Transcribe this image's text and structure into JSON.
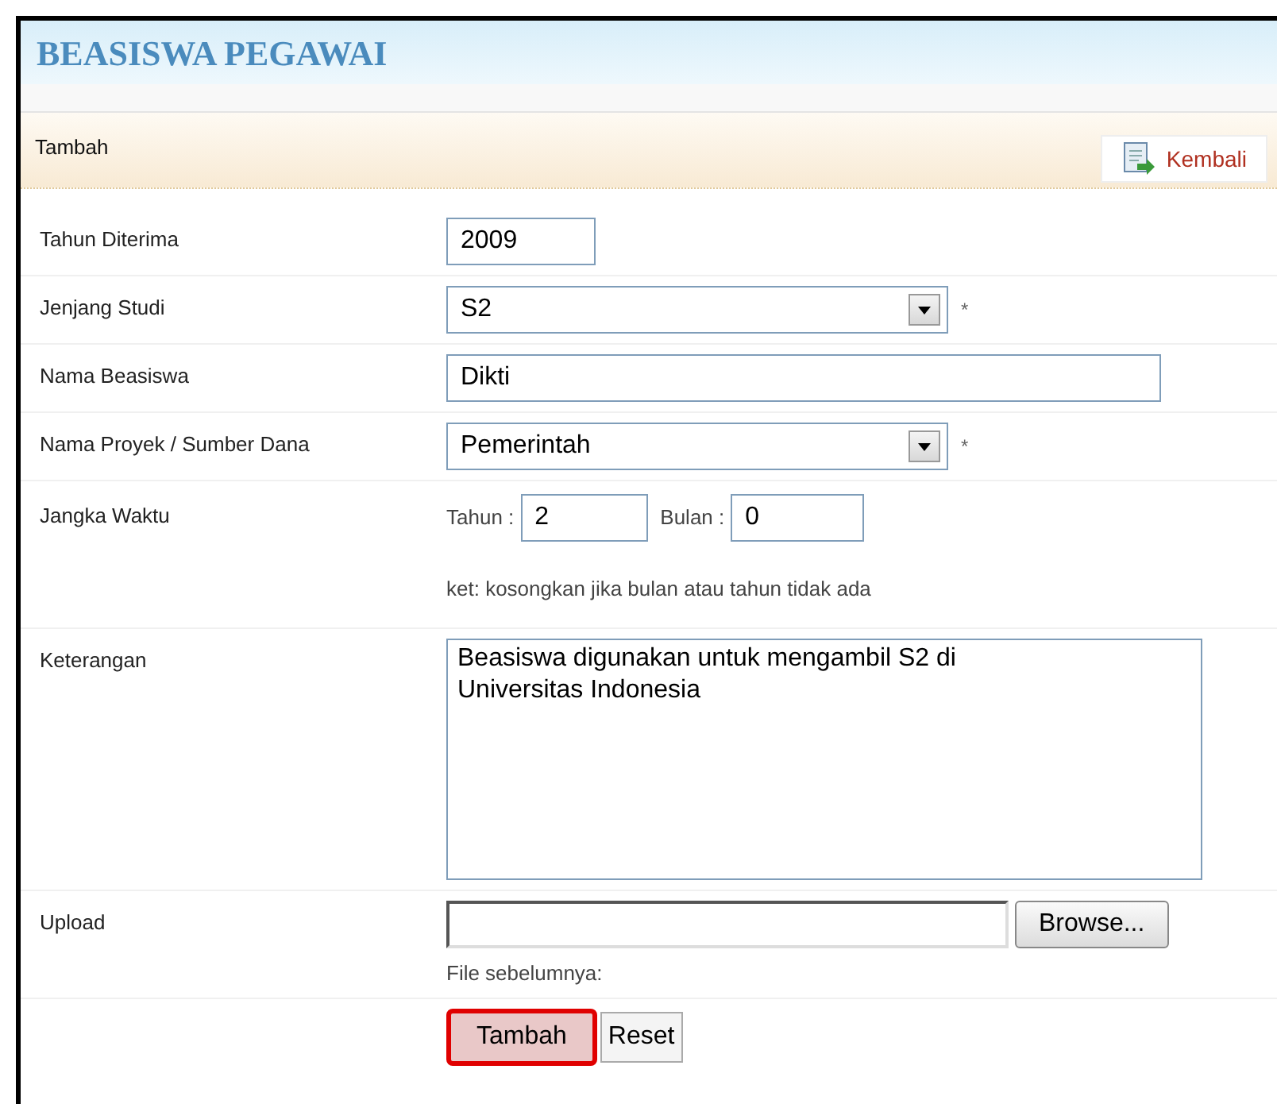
{
  "title": "BEASISWA PEGAWAI",
  "toolbar": {
    "label": "Tambah",
    "back_button": "Kembali"
  },
  "fields": [
    {
      "kind": "short_text",
      "label": "Tahun Diterima",
      "value": "2009"
    },
    {
      "kind": "select",
      "label": "Jenjang Studi",
      "value": "S2",
      "required_mark": "*"
    },
    {
      "kind": "text",
      "label": "Nama Beasiswa",
      "value": "Dikti"
    },
    {
      "kind": "select",
      "label": "Nama Proyek / Sumber Dana",
      "value": "Pemerintah",
      "required_mark": "*"
    },
    {
      "kind": "duration",
      "label": "Jangka Waktu",
      "year_label": "Tahun :",
      "year_value": "2",
      "month_label": "Bulan :",
      "month_value": "0",
      "note": "ket: kosongkan jika bulan atau tahun tidak ada"
    },
    {
      "kind": "textarea",
      "label": "Keterangan",
      "value": "Beasiswa digunakan untuk mengambil S2 di Universitas Indonesia"
    },
    {
      "kind": "file",
      "label": "Upload",
      "browse_button": "Browse...",
      "note": "File sebelumnya:"
    }
  ],
  "buttons": [
    {
      "label": "Tambah",
      "highlighted": true
    },
    {
      "label": "Reset",
      "highlighted": false
    }
  ]
}
